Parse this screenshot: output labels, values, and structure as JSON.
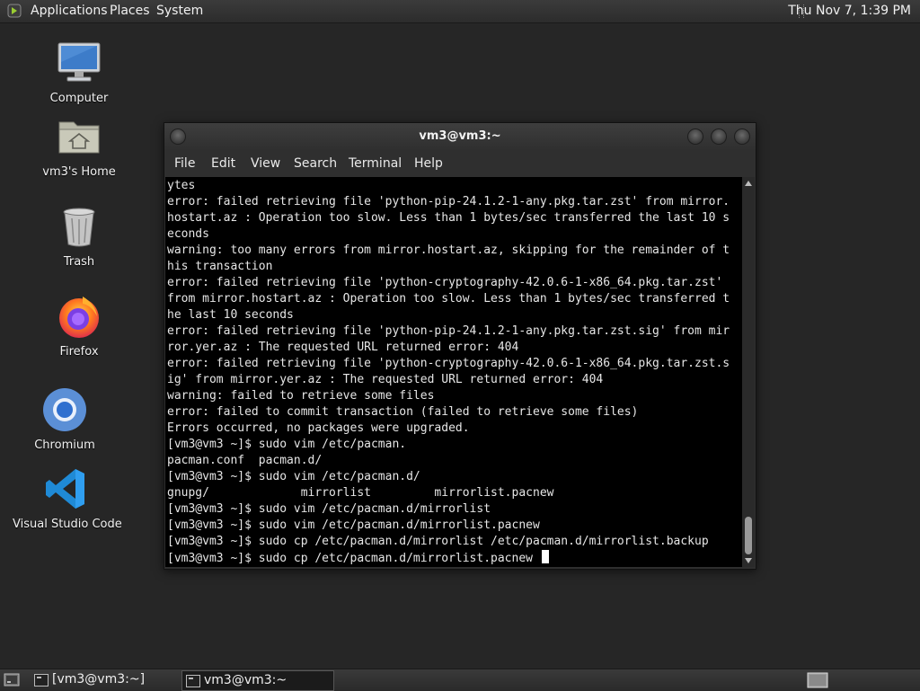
{
  "top_panel": {
    "menus": [
      "Applications",
      "Places",
      "System"
    ],
    "clock": "Thu Nov 7,  1:39 PM"
  },
  "desktop_icons": [
    {
      "label": "Computer",
      "icon": "computer-icon"
    },
    {
      "label": "vm3's Home",
      "icon": "home-folder-icon"
    },
    {
      "label": "Trash",
      "icon": "trash-icon"
    },
    {
      "label": "Firefox",
      "icon": "firefox-icon"
    },
    {
      "label": "Chromium",
      "icon": "chromium-icon"
    },
    {
      "label": "Visual Studio Code",
      "icon": "vscode-icon"
    }
  ],
  "terminal": {
    "title": "vm3@vm3:~",
    "menu": [
      "File",
      "Edit",
      "View",
      "Search",
      "Terminal",
      "Help"
    ],
    "lines": [
      "ytes",
      "error: failed retrieving file 'python-pip-24.1.2-1-any.pkg.tar.zst' from mirror.",
      "hostart.az : Operation too slow. Less than 1 bytes/sec transferred the last 10 s",
      "econds",
      "warning: too many errors from mirror.hostart.az, skipping for the remainder of t",
      "his transaction",
      "error: failed retrieving file 'python-cryptography-42.0.6-1-x86_64.pkg.tar.zst'",
      "from mirror.hostart.az : Operation too slow. Less than 1 bytes/sec transferred t",
      "he last 10 seconds",
      "error: failed retrieving file 'python-pip-24.1.2-1-any.pkg.tar.zst.sig' from mir",
      "ror.yer.az : The requested URL returned error: 404",
      "error: failed retrieving file 'python-cryptography-42.0.6-1-x86_64.pkg.tar.zst.s",
      "ig' from mirror.yer.az : The requested URL returned error: 404",
      "warning: failed to retrieve some files",
      "error: failed to commit transaction (failed to retrieve some files)",
      "Errors occurred, no packages were upgraded.",
      "[vm3@vm3 ~]$ sudo vim /etc/pacman.",
      "pacman.conf  pacman.d/",
      "[vm3@vm3 ~]$ sudo vim /etc/pacman.d/",
      "gnupg/             mirrorlist         mirrorlist.pacnew",
      "[vm3@vm3 ~]$ sudo vim /etc/pacman.d/mirrorlist",
      "[vm3@vm3 ~]$ sudo vim /etc/pacman.d/mirrorlist.pacnew",
      "[vm3@vm3 ~]$ sudo cp /etc/pacman.d/mirrorlist /etc/pacman.d/mirrorlist.backup"
    ],
    "current_prompt": "[vm3@vm3 ~]$ sudo cp /etc/pacman.d/mirrorlist.pacnew "
  },
  "taskbar": {
    "tasks": [
      {
        "label": "[vm3@vm3:~]",
        "active": false
      },
      {
        "label": "vm3@vm3:~",
        "active": true
      }
    ]
  }
}
